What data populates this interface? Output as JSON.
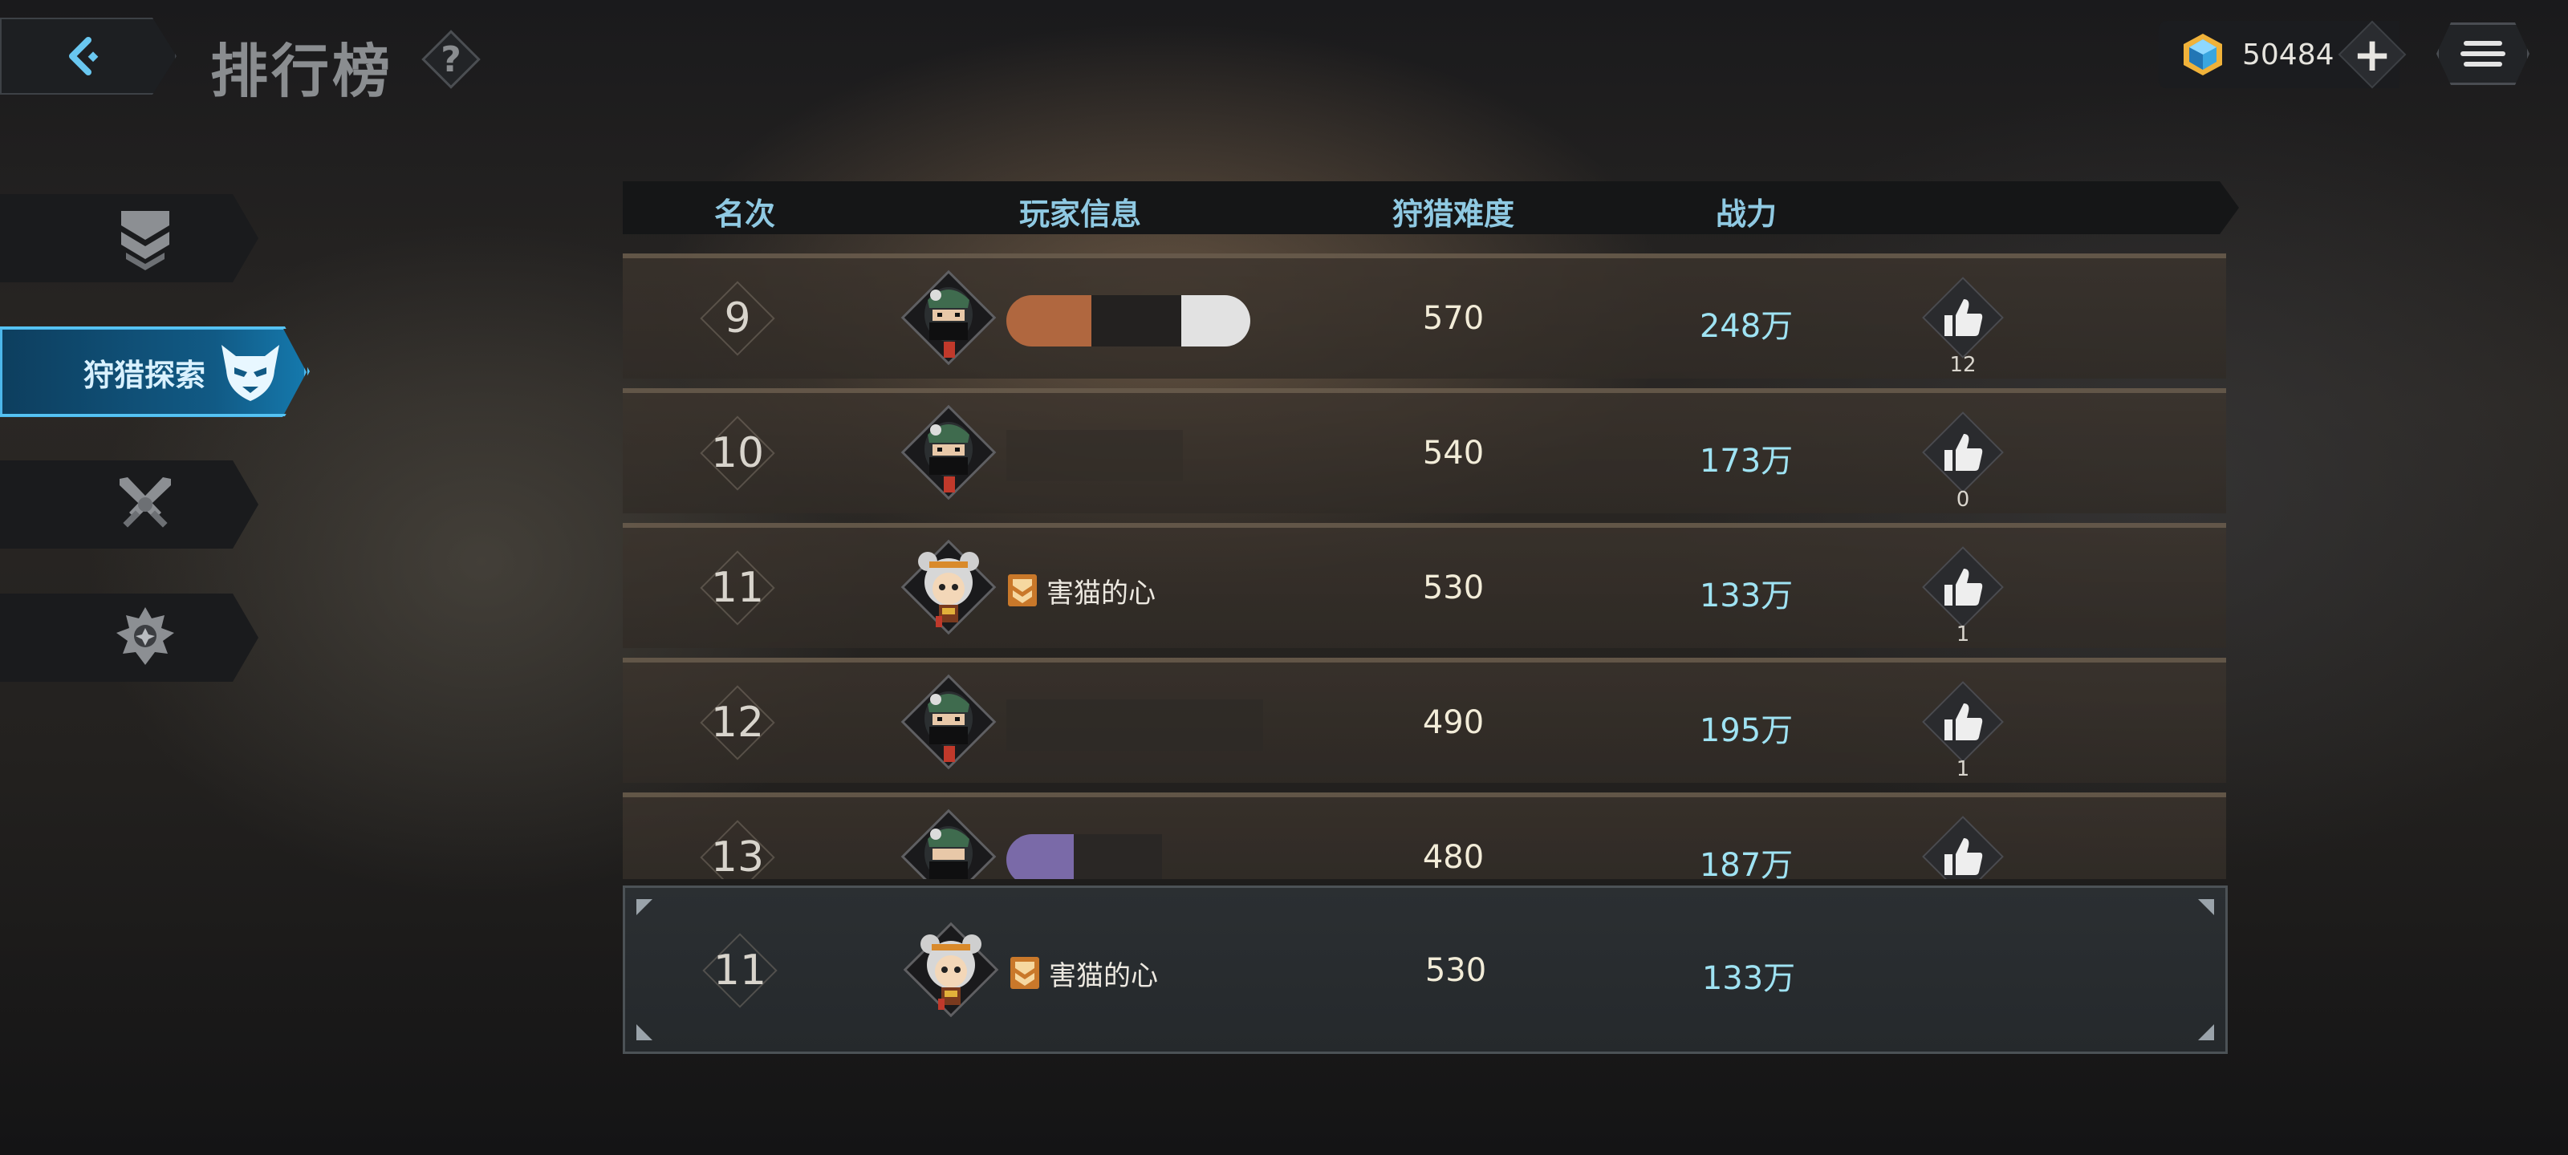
{
  "header": {
    "title": "排行榜",
    "help_label": "?",
    "currency_amount": "50484",
    "plus_label": "+"
  },
  "sidebar": {
    "tabs": [
      {
        "id": "tab1",
        "label": "",
        "icon": "chevron-rank-icon",
        "active": false
      },
      {
        "id": "tab2",
        "label": "狩猎探索",
        "icon": "demon-mask-icon",
        "active": true
      },
      {
        "id": "tab3",
        "label": "",
        "icon": "crossed-swords-icon",
        "active": false
      },
      {
        "id": "tab4",
        "label": "",
        "icon": "crest-emblem-icon",
        "active": false
      }
    ]
  },
  "table": {
    "headers": {
      "rank": "名次",
      "player": "玩家信息",
      "difficulty": "狩猎难度",
      "power": "战力"
    },
    "rows": [
      {
        "rank": "9",
        "name": "",
        "difficulty": "570",
        "power": "248万",
        "likes": "12",
        "avatar": "ninja"
      },
      {
        "rank": "10",
        "name": "",
        "difficulty": "540",
        "power": "173万",
        "likes": "0",
        "avatar": "ninja"
      },
      {
        "rank": "11",
        "name": "害猫的心",
        "difficulty": "530",
        "power": "133万",
        "likes": "1",
        "avatar": "girl"
      },
      {
        "rank": "12",
        "name": "",
        "difficulty": "490",
        "power": "195万",
        "likes": "1",
        "avatar": "ninja"
      },
      {
        "rank": "13",
        "name": "",
        "difficulty": "480",
        "power": "187万",
        "likes": "",
        "avatar": "ninja"
      }
    ]
  },
  "self": {
    "rank": "11",
    "name": "害猫的心",
    "difficulty": "530",
    "power": "133万"
  },
  "colors": {
    "accent_blue": "#1579ad",
    "power_cyan": "#9fe3f3",
    "header_text": "#8fc9e2",
    "redact_orange": "#b0673f",
    "redact_white": "#e2e2e2",
    "redact_purple": "#7a6aa8"
  }
}
